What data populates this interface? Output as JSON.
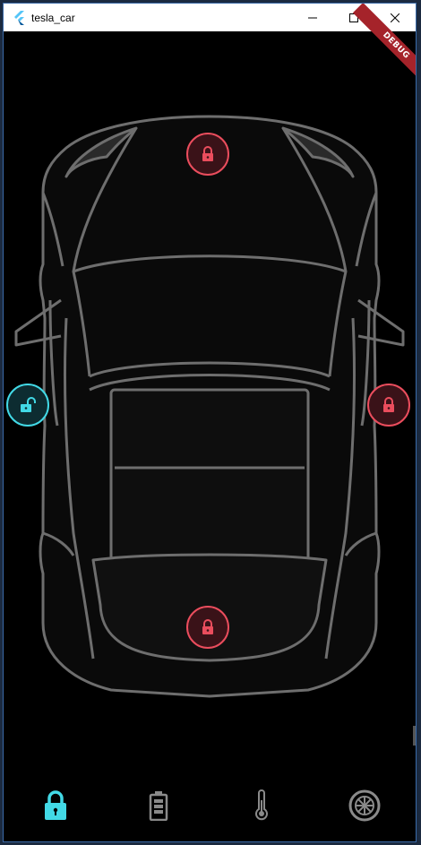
{
  "window": {
    "title": "tesla_car",
    "controls": [
      "minimize",
      "maximize",
      "close"
    ]
  },
  "debug_banner": "DEBUG",
  "doors": {
    "top": {
      "state": "locked"
    },
    "left": {
      "state": "unlocked"
    },
    "right": {
      "state": "locked"
    },
    "bottom": {
      "state": "locked"
    }
  },
  "nav": {
    "items": [
      {
        "icon": "lock-icon",
        "active": true
      },
      {
        "icon": "battery-icon",
        "active": false
      },
      {
        "icon": "thermometer-icon",
        "active": false
      },
      {
        "icon": "tyre-icon",
        "active": false
      }
    ]
  },
  "colors": {
    "locked": "#ea4d5d",
    "unlocked": "#42d9e6",
    "nav_active": "#42d9e6",
    "nav_inactive": "#8a8a8a"
  }
}
